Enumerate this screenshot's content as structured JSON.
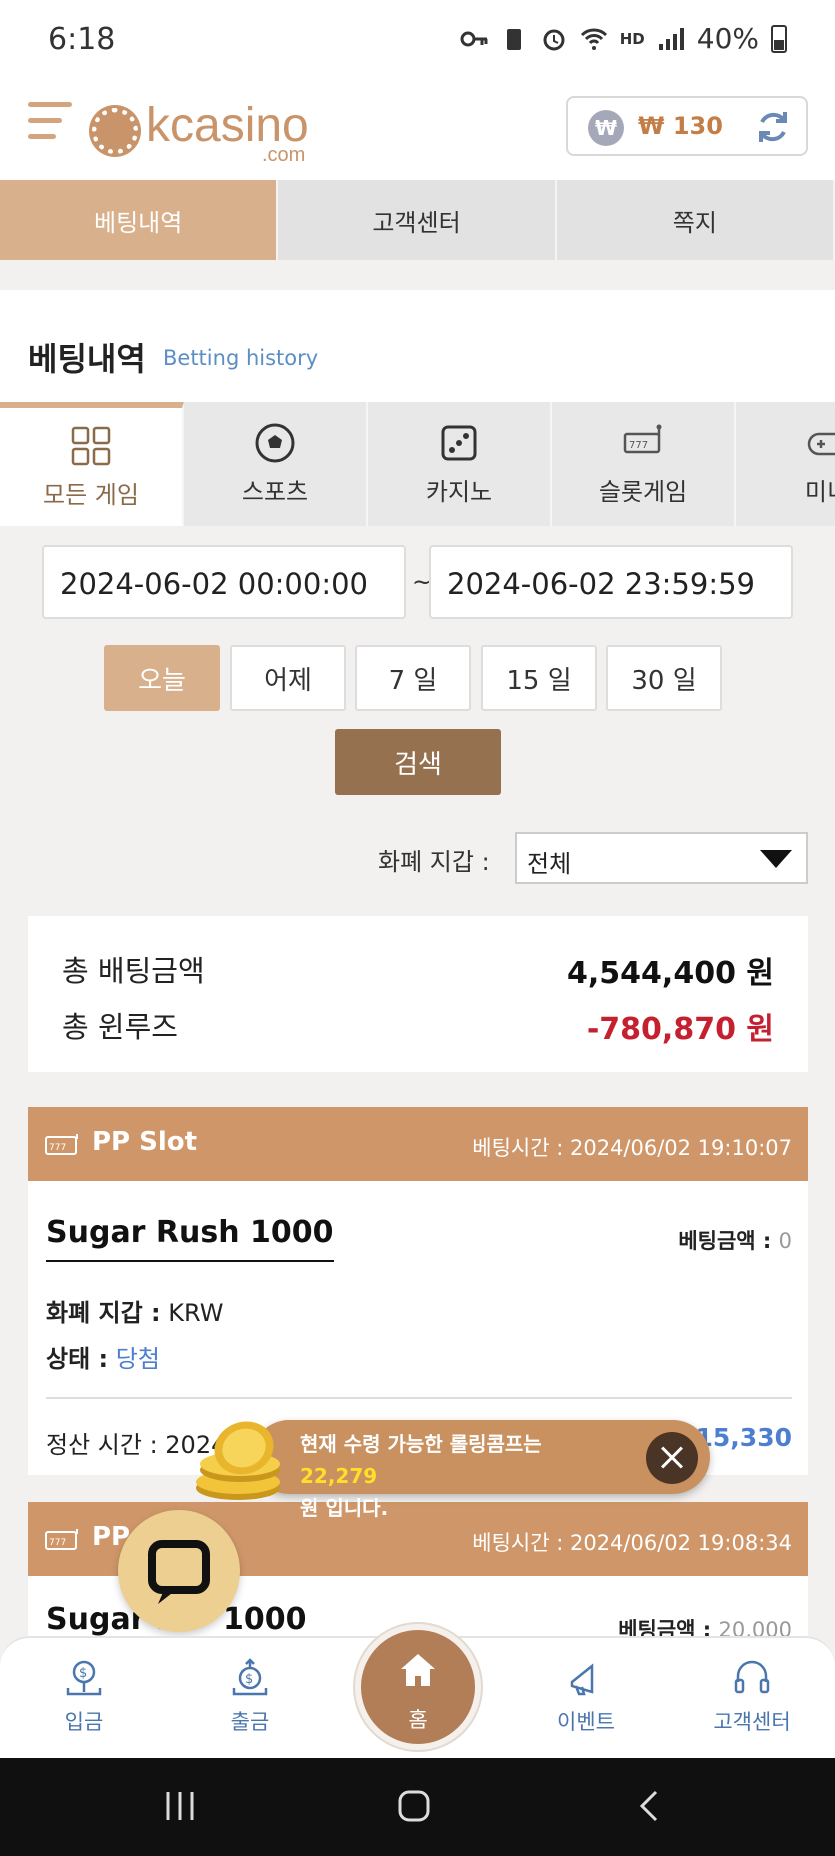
{
  "status_bar": {
    "time": "6:18",
    "network": "HD",
    "battery": "40%"
  },
  "header": {
    "logo_name": "kcasino",
    "logo_domain": ".com",
    "wallet_symbol": "₩",
    "wallet_amount": "₩ 130"
  },
  "top_tabs": [
    {
      "label": "베팅내역",
      "active": true
    },
    {
      "label": "고객센터",
      "active": false
    },
    {
      "label": "쪽지",
      "active": false
    }
  ],
  "page_title": {
    "ko": "베팅내역",
    "en": "Betting history"
  },
  "game_tabs": [
    {
      "label": "모든 게임",
      "icon": "grid-icon",
      "active": true
    },
    {
      "label": "스포츠",
      "icon": "soccer-ball-icon",
      "active": false
    },
    {
      "label": "카지노",
      "icon": "dice-icon",
      "active": false
    },
    {
      "label": "슬롯게임",
      "icon": "slot-machine-icon",
      "active": false
    },
    {
      "label": "미니",
      "icon": "gamepad-icon",
      "active": false
    }
  ],
  "date_range": {
    "start": "2024-06-02 00:00:00",
    "separator": "~",
    "end": "2024-06-02 23:59:59"
  },
  "day_buttons": [
    {
      "label": "오늘",
      "active": true
    },
    {
      "label": "어제",
      "active": false
    },
    {
      "label": "7 일",
      "active": false
    },
    {
      "label": "15 일",
      "active": false
    },
    {
      "label": "30 일",
      "active": false
    }
  ],
  "search_label": "검색",
  "currency_filter": {
    "label": "화폐 지갑 :",
    "value": "전체"
  },
  "totals": {
    "bet_label": "총 배팅금액",
    "bet_value": "4,544,400 원",
    "winloss_label": "총 윈루즈",
    "winloss_value": "-780,870 원"
  },
  "bets": [
    {
      "provider": "PP Slot",
      "bet_time": "베팅시간 : 2024/06/02 19:10:07",
      "title": "Sugar Rush 1000",
      "bet_amount_label": "베팅금액 :",
      "bet_amount_value": "0",
      "currency_label": "화폐 지갑 :",
      "currency_value": "KRW",
      "status_label": "상태 :",
      "status_value": "당첨",
      "settle_label": "정산 시간 : 2024",
      "payout": "₩ 15,330"
    },
    {
      "provider": "PP",
      "bet_time": "베팅시간 : 2024/06/02 19:08:34",
      "title": "Sugar R",
      "title_tail": "1000",
      "bet_amount_label": "베팅금액 :",
      "bet_amount_value": "20,000"
    }
  ],
  "toast": {
    "prefix": "현재 수령 가능한 롤링콤프는 ",
    "amount": "22,279",
    "suffix": "원 입니다."
  },
  "bottom_nav": {
    "deposit": "입금",
    "withdraw": "출금",
    "home": "홈",
    "event": "이벤트",
    "support": "고객센터"
  },
  "colors": {
    "accent": "#d9b08c",
    "card_header": "#cf9769",
    "search_button": "#96714f",
    "negative": "#c52030",
    "link_blue": "#4e7ed0",
    "toast_highlight": "#ffdf2a"
  }
}
